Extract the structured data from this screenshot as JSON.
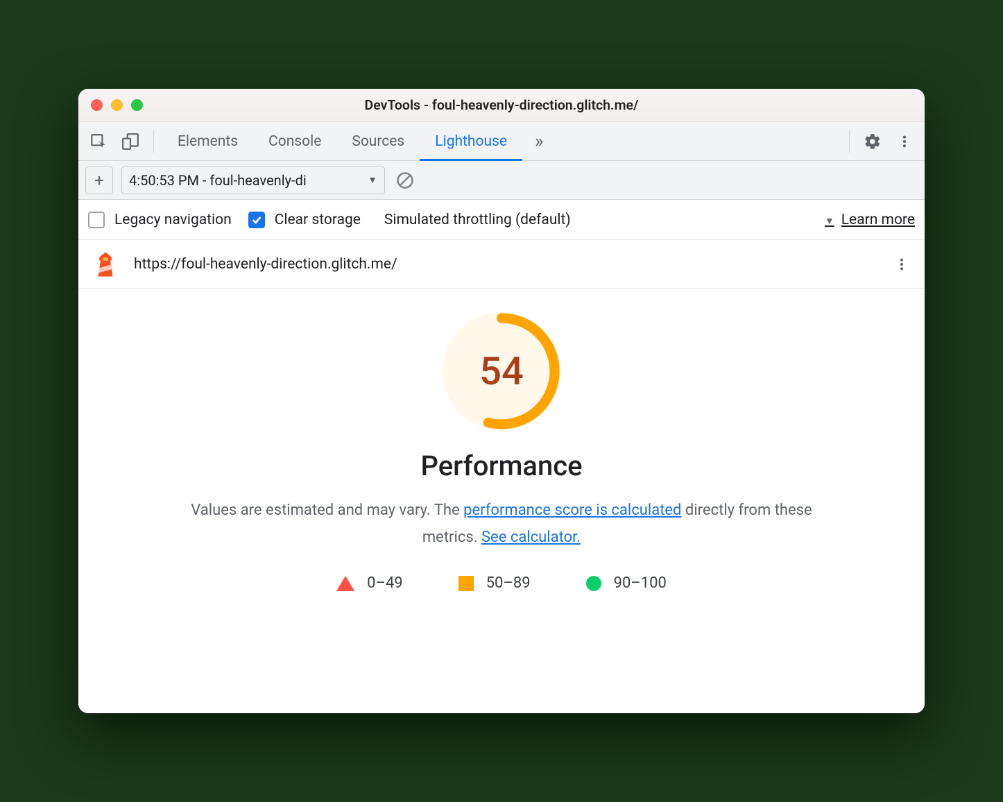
{
  "window": {
    "title": "DevTools - foul-heavenly-direction.glitch.me/"
  },
  "tabs": {
    "items": [
      "Elements",
      "Console",
      "Sources",
      "Lighthouse"
    ],
    "active": "Lighthouse"
  },
  "report_select": "4:50:53 PM - foul-heavenly-di",
  "options": {
    "legacy_label": "Legacy navigation",
    "legacy_checked": false,
    "clear_label": "Clear storage",
    "clear_checked": true,
    "throttling_label": "Simulated throttling (default)",
    "learn_more": "Learn more"
  },
  "report": {
    "url": "https://foul-heavenly-direction.glitch.me/",
    "score": 54,
    "category_title": "Performance",
    "desc_prefix": "Values are estimated and may vary. The ",
    "desc_link1": "performance score is calculated",
    "desc_mid": " directly from these metrics. ",
    "desc_link2": "See calculator."
  },
  "legend": {
    "r1": "0–49",
    "r2": "50–89",
    "r3": "90–100"
  },
  "colors": {
    "accent": "#1a73e8",
    "average": "#ffa400",
    "fail": "#ff4e42",
    "pass": "#0cce6b"
  }
}
